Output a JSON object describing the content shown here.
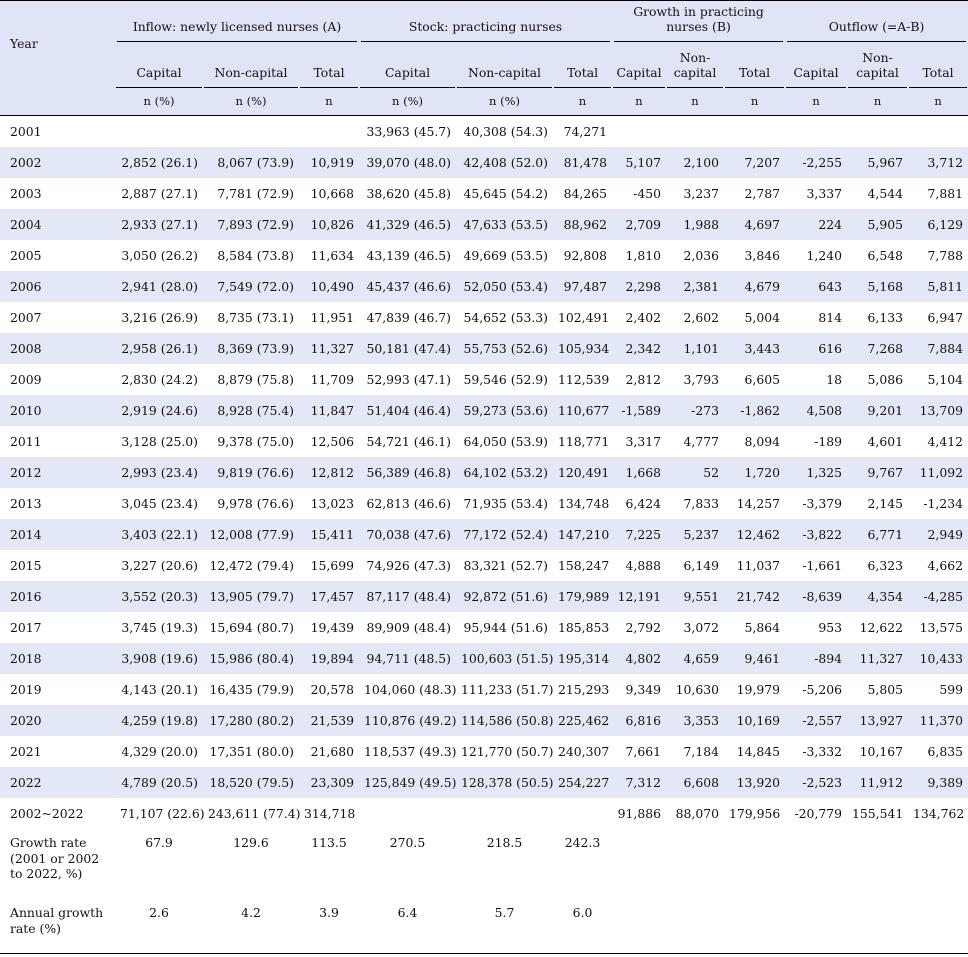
{
  "header": {
    "year_label": "Year",
    "groups": {
      "inflow": "Inflow: newly licensed nurses (A)",
      "stock": "Stock: practicing nurses",
      "growth": "Growth in practicing nurses (B)",
      "outflow": "Outflow (=A-B)"
    },
    "sub": {
      "capital": "Capital",
      "noncapital": "Non-capital",
      "total": "Total"
    },
    "units": {
      "npct": "n (%)",
      "n": "n"
    }
  },
  "rows": [
    [
      "2001",
      "",
      "",
      "",
      "33,963 (45.7)",
      "40,308 (54.3)",
      "74,271",
      "",
      "",
      "",
      "",
      "",
      ""
    ],
    [
      "2002",
      "2,852 (26.1)",
      "8,067 (73.9)",
      "10,919",
      "39,070 (48.0)",
      "42,408 (52.0)",
      "81,478",
      "5,107",
      "2,100",
      "7,207",
      "-2,255",
      "5,967",
      "3,712"
    ],
    [
      "2003",
      "2,887 (27.1)",
      "7,781 (72.9)",
      "10,668",
      "38,620 (45.8)",
      "45,645 (54.2)",
      "84,265",
      "-450",
      "3,237",
      "2,787",
      "3,337",
      "4,544",
      "7,881"
    ],
    [
      "2004",
      "2,933 (27.1)",
      "7,893 (72.9)",
      "10,826",
      "41,329 (46.5)",
      "47,633 (53.5)",
      "88,962",
      "2,709",
      "1,988",
      "4,697",
      "224",
      "5,905",
      "6,129"
    ],
    [
      "2005",
      "3,050 (26.2)",
      "8,584 (73.8)",
      "11,634",
      "43,139 (46.5)",
      "49,669 (53.5)",
      "92,808",
      "1,810",
      "2,036",
      "3,846",
      "1,240",
      "6,548",
      "7,788"
    ],
    [
      "2006",
      "2,941 (28.0)",
      "7,549 (72.0)",
      "10,490",
      "45,437 (46.6)",
      "52,050 (53.4)",
      "97,487",
      "2,298",
      "2,381",
      "4,679",
      "643",
      "5,168",
      "5,811"
    ],
    [
      "2007",
      "3,216 (26.9)",
      "8,735 (73.1)",
      "11,951",
      "47,839 (46.7)",
      "54,652 (53.3)",
      "102,491",
      "2,402",
      "2,602",
      "5,004",
      "814",
      "6,133",
      "6,947"
    ],
    [
      "2008",
      "2,958 (26.1)",
      "8,369 (73.9)",
      "11,327",
      "50,181 (47.4)",
      "55,753 (52.6)",
      "105,934",
      "2,342",
      "1,101",
      "3,443",
      "616",
      "7,268",
      "7,884"
    ],
    [
      "2009",
      "2,830 (24.2)",
      "8,879 (75.8)",
      "11,709",
      "52,993 (47.1)",
      "59,546 (52.9)",
      "112,539",
      "2,812",
      "3,793",
      "6,605",
      "18",
      "5,086",
      "5,104"
    ],
    [
      "2010",
      "2,919 (24.6)",
      "8,928 (75.4)",
      "11,847",
      "51,404 (46.4)",
      "59,273 (53.6)",
      "110,677",
      "-1,589",
      "-273",
      "-1,862",
      "4,508",
      "9,201",
      "13,709"
    ],
    [
      "2011",
      "3,128 (25.0)",
      "9,378 (75.0)",
      "12,506",
      "54,721 (46.1)",
      "64,050 (53.9)",
      "118,771",
      "3,317",
      "4,777",
      "8,094",
      "-189",
      "4,601",
      "4,412"
    ],
    [
      "2012",
      "2,993 (23.4)",
      "9,819 (76.6)",
      "12,812",
      "56,389 (46.8)",
      "64,102 (53.2)",
      "120,491",
      "1,668",
      "52",
      "1,720",
      "1,325",
      "9,767",
      "11,092"
    ],
    [
      "2013",
      "3,045 (23.4)",
      "9,978 (76.6)",
      "13,023",
      "62,813 (46.6)",
      "71,935 (53.4)",
      "134,748",
      "6,424",
      "7,833",
      "14,257",
      "-3,379",
      "2,145",
      "-1,234"
    ],
    [
      "2014",
      "3,403 (22.1)",
      "12,008 (77.9)",
      "15,411",
      "70,038 (47.6)",
      "77,172 (52.4)",
      "147,210",
      "7,225",
      "5,237",
      "12,462",
      "-3,822",
      "6,771",
      "2,949"
    ],
    [
      "2015",
      "3,227 (20.6)",
      "12,472 (79.4)",
      "15,699",
      "74,926 (47.3)",
      "83,321 (52.7)",
      "158,247",
      "4,888",
      "6,149",
      "11,037",
      "-1,661",
      "6,323",
      "4,662"
    ],
    [
      "2016",
      "3,552 (20.3)",
      "13,905 (79.7)",
      "17,457",
      "87,117 (48.4)",
      "92,872 (51.6)",
      "179,989",
      "12,191",
      "9,551",
      "21,742",
      "-8,639",
      "4,354",
      "-4,285"
    ],
    [
      "2017",
      "3,745 (19.3)",
      "15,694 (80.7)",
      "19,439",
      "89,909 (48.4)",
      "95,944 (51.6)",
      "185,853",
      "2,792",
      "3,072",
      "5,864",
      "953",
      "12,622",
      "13,575"
    ],
    [
      "2018",
      "3,908 (19.6)",
      "15,986 (80.4)",
      "19,894",
      "94,711 (48.5)",
      "100,603 (51.5)",
      "195,314",
      "4,802",
      "4,659",
      "9,461",
      "-894",
      "11,327",
      "10,433"
    ],
    [
      "2019",
      "4,143 (20.1)",
      "16,435 (79.9)",
      "20,578",
      "104,060 (48.3)",
      "111,233 (51.7)",
      "215,293",
      "9,349",
      "10,630",
      "19,979",
      "-5,206",
      "5,805",
      "599"
    ],
    [
      "2020",
      "4,259 (19.8)",
      "17,280 (80.2)",
      "21,539",
      "110,876 (49.2)",
      "114,586 (50.8)",
      "225,462",
      "6,816",
      "3,353",
      "10,169",
      "-2,557",
      "13,927",
      "11,370"
    ],
    [
      "2021",
      "4,329 (20.0)",
      "17,351 (80.0)",
      "21,680",
      "118,537 (49.3)",
      "121,770 (50.7)",
      "240,307",
      "7,661",
      "7,184",
      "14,845",
      "-3,332",
      "10,167",
      "6,835"
    ],
    [
      "2022",
      "4,789 (20.5)",
      "18,520 (79.5)",
      "23,309",
      "125,849 (49.5)",
      "128,378 (50.5)",
      "254,227",
      "7,312",
      "6,608",
      "13,920",
      "-2,523",
      "11,912",
      "9,389"
    ],
    [
      "2002~2022",
      "71,107 (22.6)",
      "243,611 (77.4)",
      "314,718",
      "",
      "",
      "",
      "91,886",
      "88,070",
      "179,956",
      "-20,779",
      "155,541",
      "134,762"
    ]
  ],
  "growth_rate": {
    "label": "Growth rate (2001 or 2002 to 2022, %)",
    "values": [
      "67.9",
      "129.6",
      "113.5",
      "270.5",
      "218.5",
      "242.3",
      "",
      "",
      "",
      "",
      "",
      ""
    ]
  },
  "annual_growth_rate": {
    "label": "Annual growth rate (%)",
    "values": [
      "2.6",
      "4.2",
      "3.9",
      "6.4",
      "5.7",
      "6.0",
      "",
      "",
      "",
      "",
      "",
      ""
    ]
  }
}
